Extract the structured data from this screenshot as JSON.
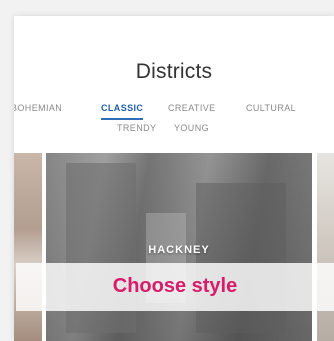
{
  "title": "Districts",
  "tabs_row1": [
    "BOHEMIAN",
    "CLASSIC",
    "CREATIVE",
    "CULTURAL"
  ],
  "tabs_row2": [
    "TRENDY",
    "YOUNG"
  ],
  "active_tab": "CLASSIC",
  "district_name": "HACKNEY",
  "cta": "Choose style",
  "colors": {
    "accent": "#d81b6a",
    "active_tab": "#1f5fa8"
  }
}
